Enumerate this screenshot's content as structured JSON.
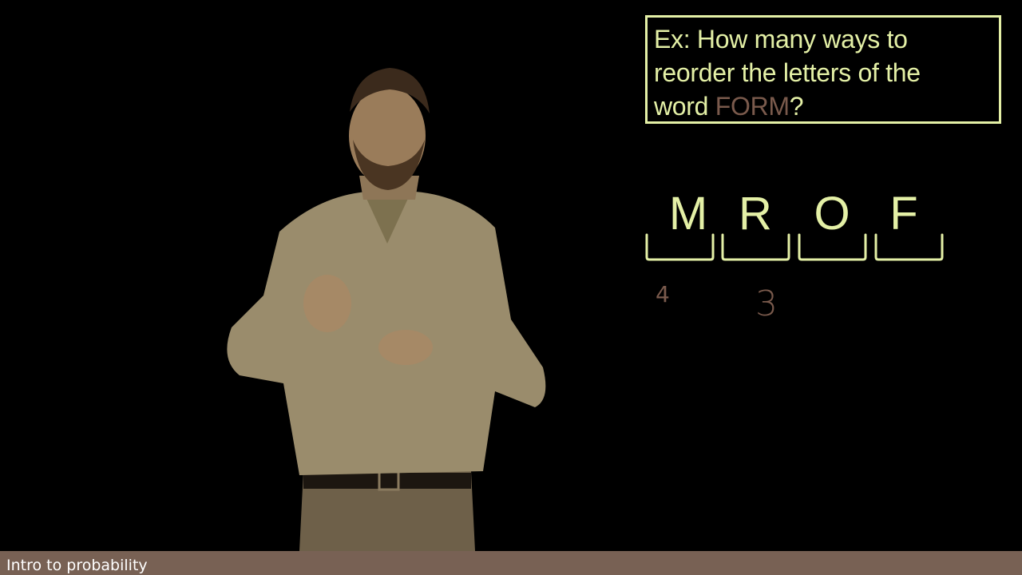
{
  "question": {
    "line1": "Ex: How many ways to",
    "line2": "reorder the letters of the",
    "line3_before": "word ",
    "line3_word": "FORM",
    "line3_after": "?"
  },
  "letters": [
    "M",
    "R",
    "O",
    "F"
  ],
  "counts": [
    "4",
    "3"
  ],
  "footer": {
    "label": "Intro to probability"
  },
  "colors": {
    "background": "#000000",
    "chalk": "#e4f0a6",
    "highlight": "#7a5a4c",
    "banner": "#786154"
  }
}
